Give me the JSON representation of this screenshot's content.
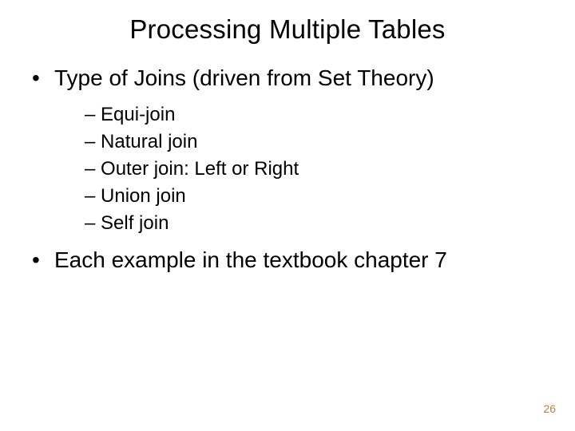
{
  "title": "Processing Multiple Tables",
  "bullets": {
    "b0": "Type of Joins (driven from Set Theory)",
    "b1": "Each example in the textbook chapter 7"
  },
  "sub": {
    "s0": "Equi-join",
    "s1": "Natural join",
    "s2": "Outer join: Left or Right",
    "s3": "Union join",
    "s4": "Self join"
  },
  "glyph": {
    "bullet": "•",
    "dash": "–"
  },
  "pageNumber": "26"
}
